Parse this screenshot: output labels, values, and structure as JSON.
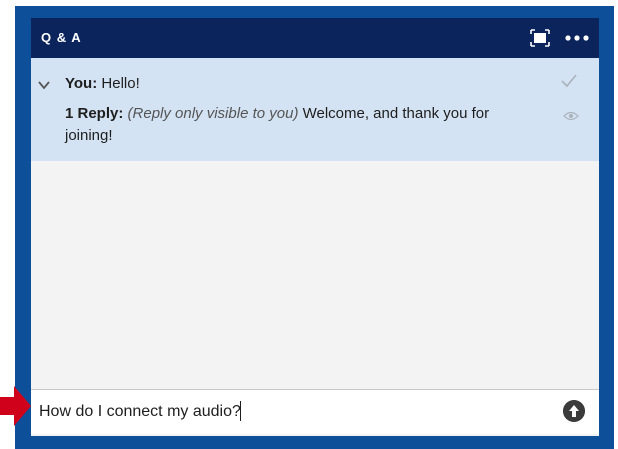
{
  "panel": {
    "title": "Q & A"
  },
  "thread": {
    "question_author": "You:",
    "question_text": "Hello!",
    "reply_label": "1 Reply:",
    "reply_note": "(Reply only visible to you)",
    "reply_text": "Welcome, and thank you for joining!"
  },
  "composer": {
    "value": "How do I connect my audio?"
  },
  "colors": {
    "header": "#0b245c",
    "frame": "#0e4f9a",
    "thread_bg": "#d4e3f3",
    "arrow": "#d0021b"
  },
  "icons": [
    "expand-icon",
    "more-icon",
    "chevron-down-icon",
    "check-icon",
    "eye-icon",
    "send-icon",
    "pointer-arrow-icon"
  ]
}
